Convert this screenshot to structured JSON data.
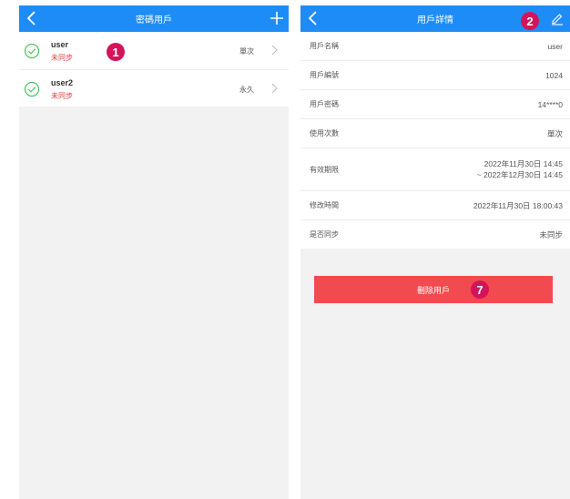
{
  "left_screen": {
    "title": "密碼用戶",
    "users": [
      {
        "name": "user",
        "status": "未同步",
        "type": "單次"
      },
      {
        "name": "user2",
        "status": "未同步",
        "type": "永久"
      }
    ]
  },
  "right_screen": {
    "title": "用戶詳情",
    "rows": [
      {
        "label": "用戶名稱",
        "value": "user"
      },
      {
        "label": "用戶編號",
        "value": "1024"
      },
      {
        "label": "用戶密碼",
        "value": "14****0"
      },
      {
        "label": "使用次數",
        "value": "單次"
      },
      {
        "label": "有效期限",
        "value": "2022年11月30日 14:45",
        "value2": "~ 2022年12月30日 14:45"
      },
      {
        "label": "修改時間",
        "value": "2022年11月30日 18:00:43"
      },
      {
        "label": "是否同步",
        "value": "未同步"
      }
    ],
    "delete_label": "刪除用戶"
  },
  "annotations": {
    "one": "1",
    "two": "2",
    "seven": "7"
  },
  "colors": {
    "navbar": "#1e8cf6",
    "delete": "#f14b4f",
    "badge": "#d4145a",
    "check": "#4cc35c",
    "status": "#e0423f"
  },
  "icons": {
    "back": "chevron-left-icon",
    "add": "plus-icon",
    "edit": "pencil-icon",
    "check": "check-circle-icon",
    "row_arrow": "chevron-right-icon"
  }
}
